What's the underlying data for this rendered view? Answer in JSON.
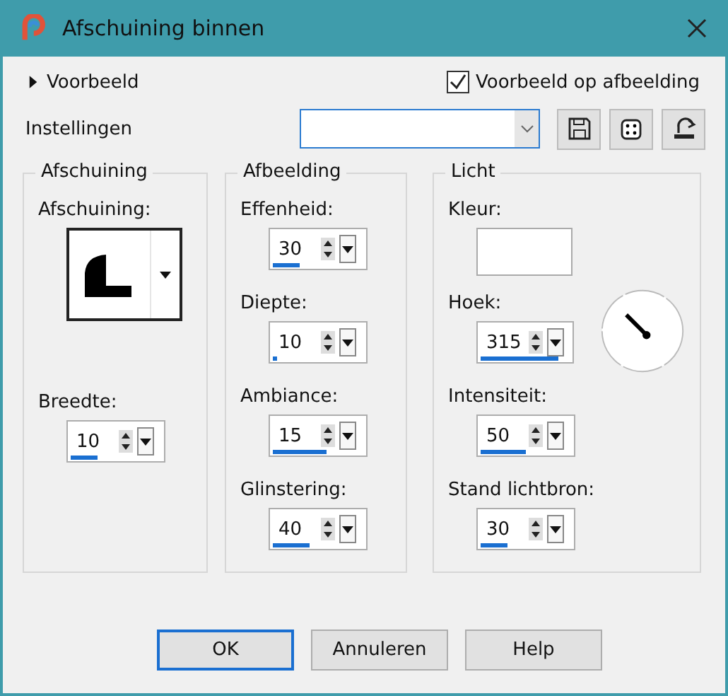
{
  "window": {
    "title": "Afschuining binnen"
  },
  "preview": {
    "label": "Voorbeeld",
    "expanded": false
  },
  "preview_on_image": {
    "label": "Voorbeeld op afbeelding",
    "checked": true
  },
  "settings": {
    "label": "Instellingen"
  },
  "groups": [
    {
      "title": "Afschuining",
      "controls": [
        {
          "kind": "shape",
          "label": "Afschuining:"
        },
        {
          "kind": "spin",
          "label": "Breedte:",
          "value": "10",
          "level": 0.3
        }
      ]
    },
    {
      "title": "Afbeelding",
      "controls": [
        {
          "kind": "spin",
          "label": "Effenheid:",
          "value": "30",
          "level": 0.3
        },
        {
          "kind": "spin",
          "label": "Diepte:",
          "value": "10",
          "level": 0.05
        },
        {
          "kind": "spin",
          "label": "Ambiance:",
          "value": "15",
          "level": 0.6
        },
        {
          "kind": "spin",
          "label": "Glinstering:",
          "value": "40",
          "level": 0.4
        }
      ]
    },
    {
      "title": "Licht",
      "controls": [
        {
          "kind": "color",
          "label": "Kleur:"
        },
        {
          "kind": "dial",
          "label": "Hoek:",
          "value": "315",
          "level": 0.87
        },
        {
          "kind": "spin",
          "label": "Intensiteit:",
          "value": "50",
          "level": 0.5
        },
        {
          "kind": "spin",
          "label": "Stand lichtbron:",
          "value": "30",
          "level": 0.3
        }
      ]
    }
  ],
  "buttons": [
    {
      "label": "OK",
      "default": true
    },
    {
      "label": "Annuleren",
      "default": false
    },
    {
      "label": "Help",
      "default": false
    }
  ]
}
